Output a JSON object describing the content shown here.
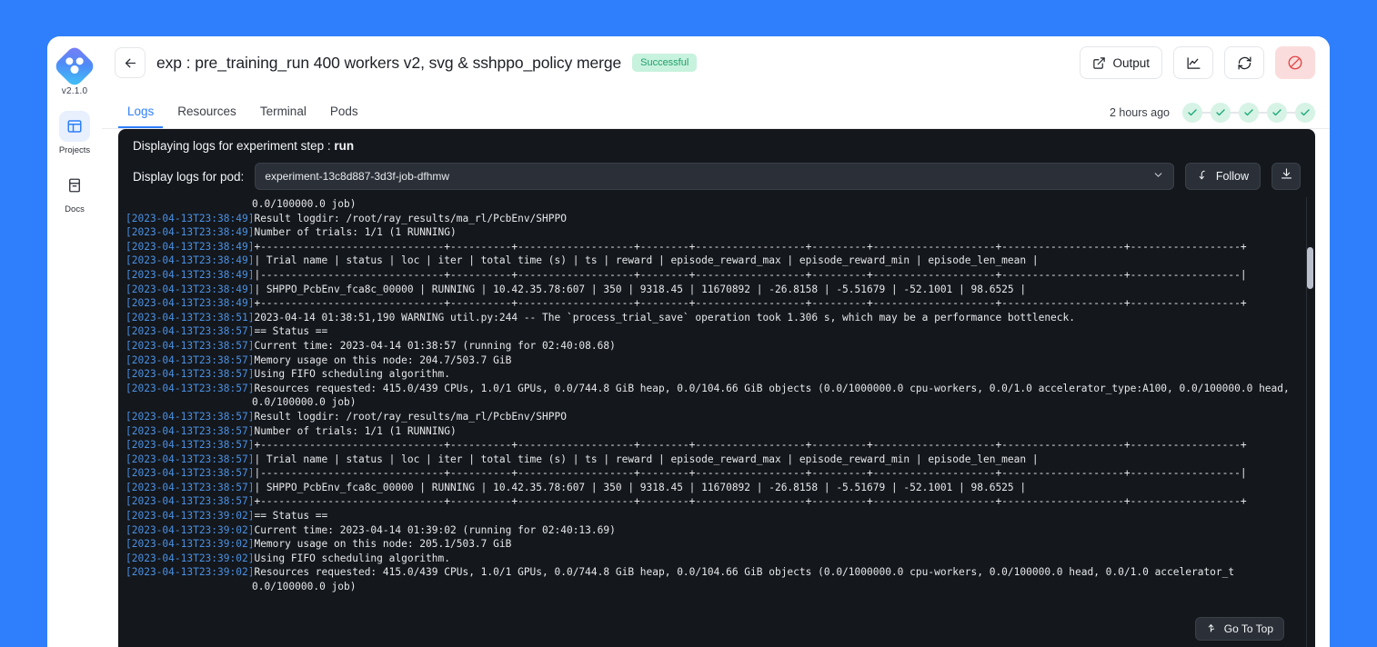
{
  "theme": {
    "page_background": "#2f7ffc",
    "accent": "#2f7ffc",
    "success": "#1f9f6b",
    "log_background": "#14171c",
    "log_timestamp": "#4a90e2"
  },
  "sidebar": {
    "version": "v2.1.0",
    "items": [
      {
        "label": "Projects",
        "icon": "layout-icon",
        "active": true
      },
      {
        "label": "Docs",
        "icon": "book-icon",
        "active": false
      }
    ]
  },
  "topbar": {
    "back_label": "←",
    "title": "exp : pre_training_run 400 workers v2, svg & sshppo_policy merge",
    "status_badge": "Successful",
    "output_label": "Output",
    "chart_icon": "line-chart-icon",
    "refresh_icon": "refresh-icon",
    "stop_icon": "stop-circle-icon"
  },
  "tabs": [
    {
      "label": "Logs",
      "active": true
    },
    {
      "label": "Resources",
      "active": false
    },
    {
      "label": "Terminal",
      "active": false
    },
    {
      "label": "Pods",
      "active": false
    }
  ],
  "status_row": {
    "time_ago": "2 hours ago",
    "steps": [
      {
        "state": "check"
      },
      {
        "state": "check"
      },
      {
        "state": "check"
      },
      {
        "state": "check"
      },
      {
        "state": "check"
      }
    ]
  },
  "logs_header": {
    "displaying_prefix": "Displaying logs for experiment step :",
    "step_name": "run",
    "pod_label": "Display logs for pod:",
    "pod_value": "experiment-13c8d887-3d3f-job-dfhmw",
    "follow_label": "Follow",
    "download_icon": "download-icon",
    "chevron_icon": "chevron-down-icon"
  },
  "go_to_top": {
    "label": "Go To Top",
    "icon": "arrow-up-curve-icon"
  },
  "log_lines": [
    {
      "ts": "",
      "msg": "0.0/100000.0 job)"
    },
    {
      "ts": "[2023-04-13T23:38:49]",
      "msg": "Result logdir: /root/ray_results/ma_rl/PcbEnv/SHPPO"
    },
    {
      "ts": "[2023-04-13T23:38:49]",
      "msg": "Number of trials: 1/1 (1 RUNNING)"
    },
    {
      "ts": "[2023-04-13T23:38:49]",
      "msg": "+------------------------------+----------+-------------------+--------+------------------+---------+--------------------+--------------------+------------------+"
    },
    {
      "ts": "[2023-04-13T23:38:49]",
      "msg": "| Trial name | status | loc | iter | total time (s) | ts | reward | episode_reward_max | episode_reward_min | episode_len_mean |"
    },
    {
      "ts": "[2023-04-13T23:38:49]",
      "msg": "|------------------------------+----------+-------------------+--------+------------------+---------+--------------------+--------------------+------------------|"
    },
    {
      "ts": "[2023-04-13T23:38:49]",
      "msg": "| SHPPO_PcbEnv_fca8c_00000 | RUNNING | 10.42.35.78:607 | 350 | 9318.45 | 11670892 | -26.8158 | -5.51679 | -52.1001 | 98.6525 |"
    },
    {
      "ts": "[2023-04-13T23:38:49]",
      "msg": "+------------------------------+----------+-------------------+--------+------------------+---------+--------------------+--------------------+------------------+"
    },
    {
      "ts": "[2023-04-13T23:38:51]",
      "msg": "2023-04-14 01:38:51,190 WARNING util.py:244 -- The `process_trial_save` operation took 1.306 s, which may be a performance bottleneck."
    },
    {
      "ts": "[2023-04-13T23:38:57]",
      "msg": "== Status =="
    },
    {
      "ts": "[2023-04-13T23:38:57]",
      "msg": "Current time: 2023-04-14 01:38:57 (running for 02:40:08.68)"
    },
    {
      "ts": "[2023-04-13T23:38:57]",
      "msg": "Memory usage on this node: 204.7/503.7 GiB"
    },
    {
      "ts": "[2023-04-13T23:38:57]",
      "msg": "Using FIFO scheduling algorithm."
    },
    {
      "ts": "[2023-04-13T23:38:57]",
      "msg": "Resources requested: 415.0/439 CPUs, 1.0/1 GPUs, 0.0/744.8 GiB heap, 0.0/104.66 GiB objects (0.0/1000000.0 cpu-workers, 0.0/1.0 accelerator_type:A100, 0.0/100000.0 head,"
    },
    {
      "ts": "",
      "msg": "0.0/100000.0 job)"
    },
    {
      "ts": "[2023-04-13T23:38:57]",
      "msg": "Result logdir: /root/ray_results/ma_rl/PcbEnv/SHPPO"
    },
    {
      "ts": "[2023-04-13T23:38:57]",
      "msg": "Number of trials: 1/1 (1 RUNNING)"
    },
    {
      "ts": "[2023-04-13T23:38:57]",
      "msg": "+------------------------------+----------+-------------------+--------+------------------+---------+--------------------+--------------------+------------------+"
    },
    {
      "ts": "[2023-04-13T23:38:57]",
      "msg": "| Trial name | status | loc | iter | total time (s) | ts | reward | episode_reward_max | episode_reward_min | episode_len_mean |"
    },
    {
      "ts": "[2023-04-13T23:38:57]",
      "msg": "|------------------------------+----------+-------------------+--------+------------------+---------+--------------------+--------------------+------------------|"
    },
    {
      "ts": "[2023-04-13T23:38:57]",
      "msg": "| SHPPO_PcbEnv_fca8c_00000 | RUNNING | 10.42.35.78:607 | 350 | 9318.45 | 11670892 | -26.8158 | -5.51679 | -52.1001 | 98.6525 |"
    },
    {
      "ts": "[2023-04-13T23:38:57]",
      "msg": "+------------------------------+----------+-------------------+--------+------------------+---------+--------------------+--------------------+------------------+"
    },
    {
      "ts": "[2023-04-13T23:39:02]",
      "msg": "== Status =="
    },
    {
      "ts": "[2023-04-13T23:39:02]",
      "msg": "Current time: 2023-04-14 01:39:02 (running for 02:40:13.69)"
    },
    {
      "ts": "[2023-04-13T23:39:02]",
      "msg": "Memory usage on this node: 205.1/503.7 GiB"
    },
    {
      "ts": "[2023-04-13T23:39:02]",
      "msg": "Using FIFO scheduling algorithm."
    },
    {
      "ts": "[2023-04-13T23:39:02]",
      "msg": "Resources requested: 415.0/439 CPUs, 1.0/1 GPUs, 0.0/744.8 GiB heap, 0.0/104.66 GiB objects (0.0/1000000.0 cpu-workers, 0.0/100000.0 head, 0.0/1.0 accelerator_t"
    },
    {
      "ts": "",
      "msg": "0.0/100000.0 job)"
    }
  ]
}
